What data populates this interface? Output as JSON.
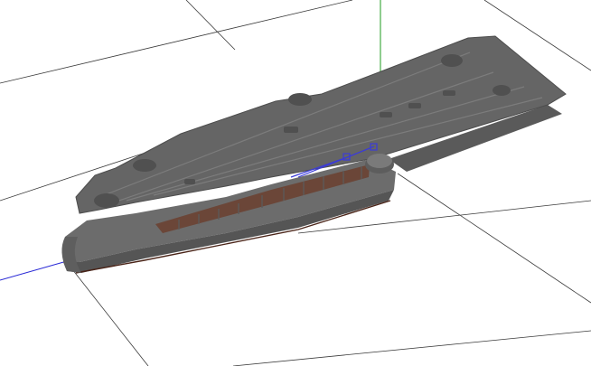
{
  "viewport": {
    "view": "perspective",
    "background_color": "#ffffff"
  },
  "colors": {
    "grid": "#3a3a3a",
    "axis_y": "#1f9b1f",
    "axis_x": "#2a2ad6",
    "hull_dark": "#575757",
    "hull_mid": "#6a6a6a",
    "hull_light": "#7a7a7a",
    "deck": "#636363",
    "deck_edge": "#4a4a4a",
    "interior_wood": "#6b4638",
    "selection": "#3b3bd8"
  },
  "scene": {
    "object": "aircraft-carrier-hull-model",
    "selected": true,
    "shading": "textured"
  }
}
